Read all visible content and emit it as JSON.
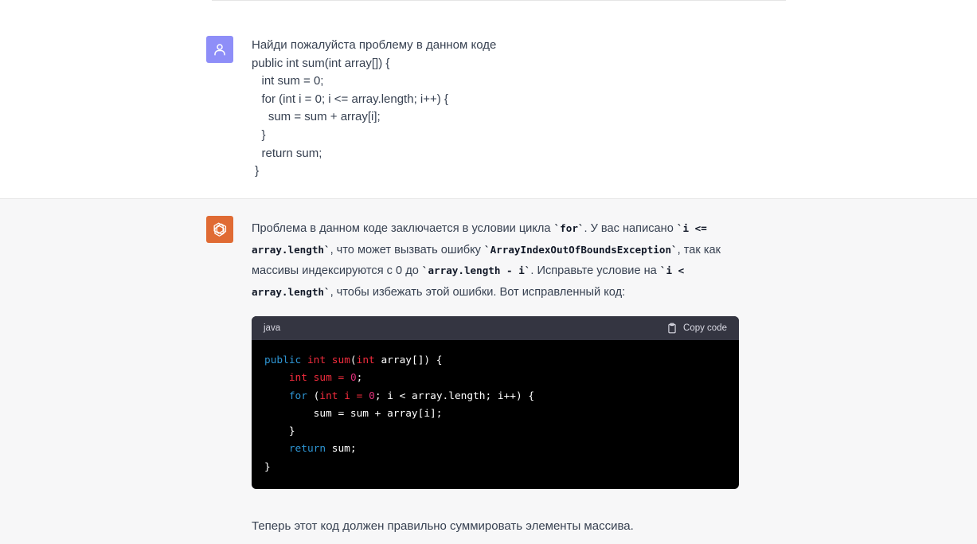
{
  "user_message": {
    "lines": [
      "Найди пожалуйста проблему в данном коде",
      "public int sum(int array[]) {",
      "   int sum = 0;",
      "   for (int i = 0; i <= array.length; i++) {",
      "     sum = sum + array[i];",
      "   }",
      "   return sum;",
      " }"
    ]
  },
  "assistant_message": {
    "intro": {
      "t1": "Проблема в данном коде заключается в условии цикла ",
      "c1": "`for`",
      "t2": ". У вас написано ",
      "c2": "`i <= array.length`",
      "t3": ", что может вызвать ошибку ",
      "c3": "`ArrayIndexOutOfBoundsException`",
      "t4": ", так как массивы индексируются с 0 до ",
      "c4": "`array.length - i`",
      "t5": ". Исправьте условие на ",
      "c5": "`i < array.length`",
      "t6": ", чтобы избежать этой ошибки. Вот исправленный код:"
    },
    "code_block": {
      "language": "java",
      "copy_label": "Copy code",
      "lines": {
        "l1": {
          "a": "public",
          "b": " ",
          "c": "int",
          "d": " ",
          "e": "sum",
          "f": "(",
          "g": "int",
          "h": " array[]) {"
        },
        "l2": {
          "indent": "    ",
          "a": "int",
          "b": " ",
          "c": "sum",
          "d": " ",
          "e": "=",
          "f": " ",
          "g": "0",
          "h": ";"
        },
        "l3": {
          "indent": "    ",
          "a": "for",
          "b": " (",
          "c": "int",
          "d": " ",
          "e": "i",
          "f": " ",
          "g": "=",
          "h": " ",
          "i": "0",
          "j": "; i < array.length; i++) {"
        },
        "l4": {
          "text": "        sum = sum + array[i];"
        },
        "l5": {
          "text": "    }"
        },
        "l6": {
          "indent": "    ",
          "a": "return",
          "b": " sum;"
        },
        "l7": {
          "text": "}"
        }
      }
    },
    "outro": "Теперь этот код должен правильно суммировать элементы массива."
  },
  "colors": {
    "user_avatar_bg": "#8e8ef8",
    "assistant_avatar_bg": "#e06b34",
    "assistant_msg_bg": "#f7f7f8",
    "code_header_bg": "#343541",
    "code_bg": "#000000",
    "keyword_blue": "#2e95d3",
    "keyword_red": "#f22c3d",
    "number_pink": "#df3079"
  },
  "icons": {
    "user_avatar": "user-icon",
    "assistant_avatar": "openai-logo-icon",
    "copy": "clipboard-icon"
  }
}
